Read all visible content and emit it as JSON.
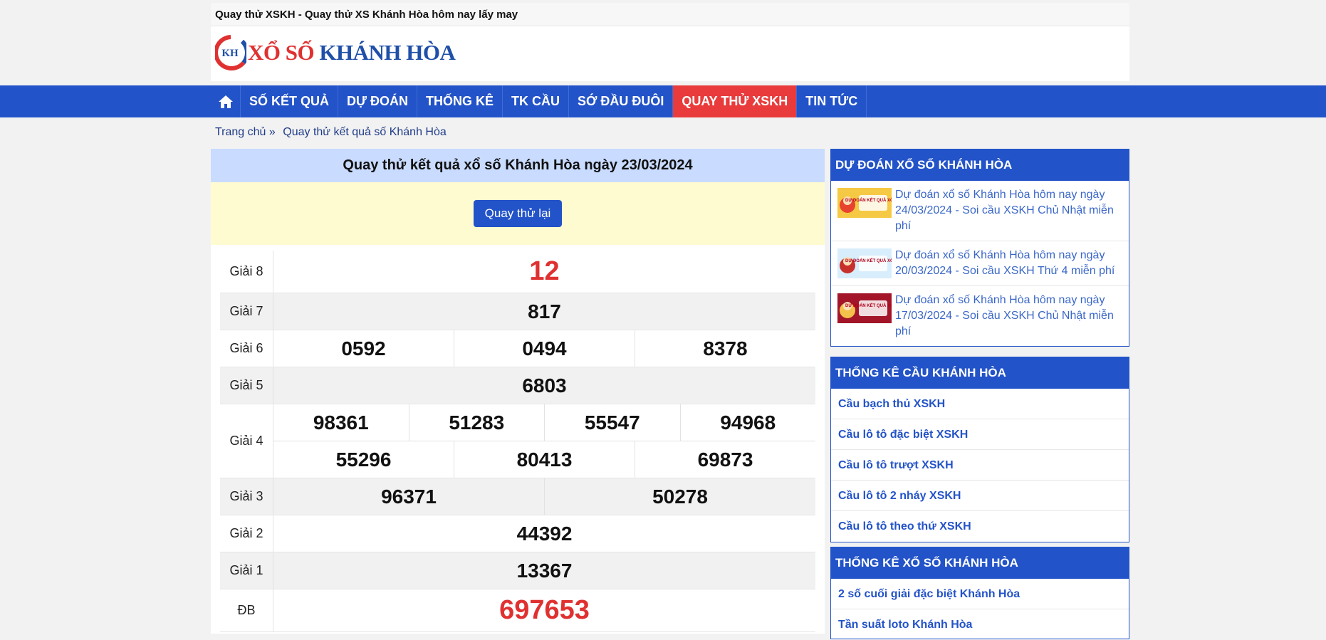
{
  "site": {
    "top_title": "Quay thử XSKH - Quay thử XS Khánh Hòa hôm nay lấy may",
    "logo_badge": "KH",
    "logo_text_red": "XỔ SỐ",
    "logo_text_blue": "KHÁNH HÒA"
  },
  "nav": {
    "items": [
      "SỐ KẾT QUẢ",
      "DỰ ĐOÁN",
      "THỐNG KÊ",
      "TK CẦU",
      "SỚ ĐẦU ĐUÔI",
      "QUAY THỬ XSKH",
      "TIN TỨC"
    ],
    "active": "QUAY THỬ XSKH"
  },
  "breadcrumb": {
    "home": "Trang chủ »",
    "current": "Quay thử kết quả số Khánh Hòa"
  },
  "main": {
    "title": "Quay thử kết quả xổ số Khánh Hòa ngày 23/03/2024",
    "spin_button": "Quay thử lại",
    "prizes": [
      {
        "label": "Giải 8",
        "lines": [
          [
            "12"
          ]
        ]
      },
      {
        "label": "Giải 7",
        "lines": [
          [
            "817"
          ]
        ]
      },
      {
        "label": "Giải 6",
        "lines": [
          [
            "0592",
            "0494",
            "8378"
          ]
        ]
      },
      {
        "label": "Giải 5",
        "lines": [
          [
            "6803"
          ]
        ]
      },
      {
        "label": "Giải 4",
        "lines": [
          [
            "98361",
            "51283",
            "55547",
            "94968"
          ],
          [
            "55296",
            "80413",
            "69873"
          ]
        ]
      },
      {
        "label": "Giải 3",
        "lines": [
          [
            "96371",
            "50278"
          ]
        ]
      },
      {
        "label": "Giải 2",
        "lines": [
          [
            "44392"
          ]
        ]
      },
      {
        "label": "Giải 1",
        "lines": [
          [
            "13367"
          ]
        ]
      },
      {
        "label": "ĐB",
        "lines": [
          [
            "697653"
          ]
        ]
      }
    ]
  },
  "sidebar": {
    "predict": {
      "heading": "DỰ ĐOÁN XỔ SỐ KHÁNH HÒA",
      "items": [
        "Dự đoán xổ số Khánh Hòa hôm nay ngày 24/03/2024 - Soi cầu XSKH Chủ Nhật miễn phí",
        "Dự đoán xổ số Khánh Hòa hôm nay ngày 20/03/2024 - Soi cầu XSKH Thứ 4 miễn phí",
        "Dự đoán xổ số Khánh Hòa hôm nay ngày 17/03/2024 - Soi cầu XSKH Chủ Nhật miễn phí"
      ],
      "thumb_texts": [
        "DỰ ĐOÁN KẾT QUẢ XỔ SỐ",
        "DỰ ĐOÁN KẾT QUẢ XỔ SỐ",
        "DỰ ĐOÁN KẾT QUẢ XỔ SỐ"
      ]
    },
    "cau": {
      "heading": "THỐNG KÊ CẦU KHÁNH HÒA",
      "items": [
        "Cầu bạch thủ XSKH",
        "Cầu lô tô đặc biệt XSKH",
        "Cầu lô tô trượt XSKH",
        "Cầu lô tô 2 nháy XSKH",
        "Cầu lô tô theo thứ XSKH"
      ]
    },
    "stats": {
      "heading": "THỐNG KÊ XỔ SỐ KHÁNH HÒA",
      "items": [
        "2 số cuối giải đặc biệt Khánh Hòa",
        "Tần suất loto Khánh Hòa"
      ]
    }
  },
  "colors": {
    "nav_bg": "#2353c8",
    "active_nav": "#e93b3b",
    "highlight_number": "#e03131",
    "title_band": "#c9dbff",
    "spin_band": "#fffbd1"
  }
}
